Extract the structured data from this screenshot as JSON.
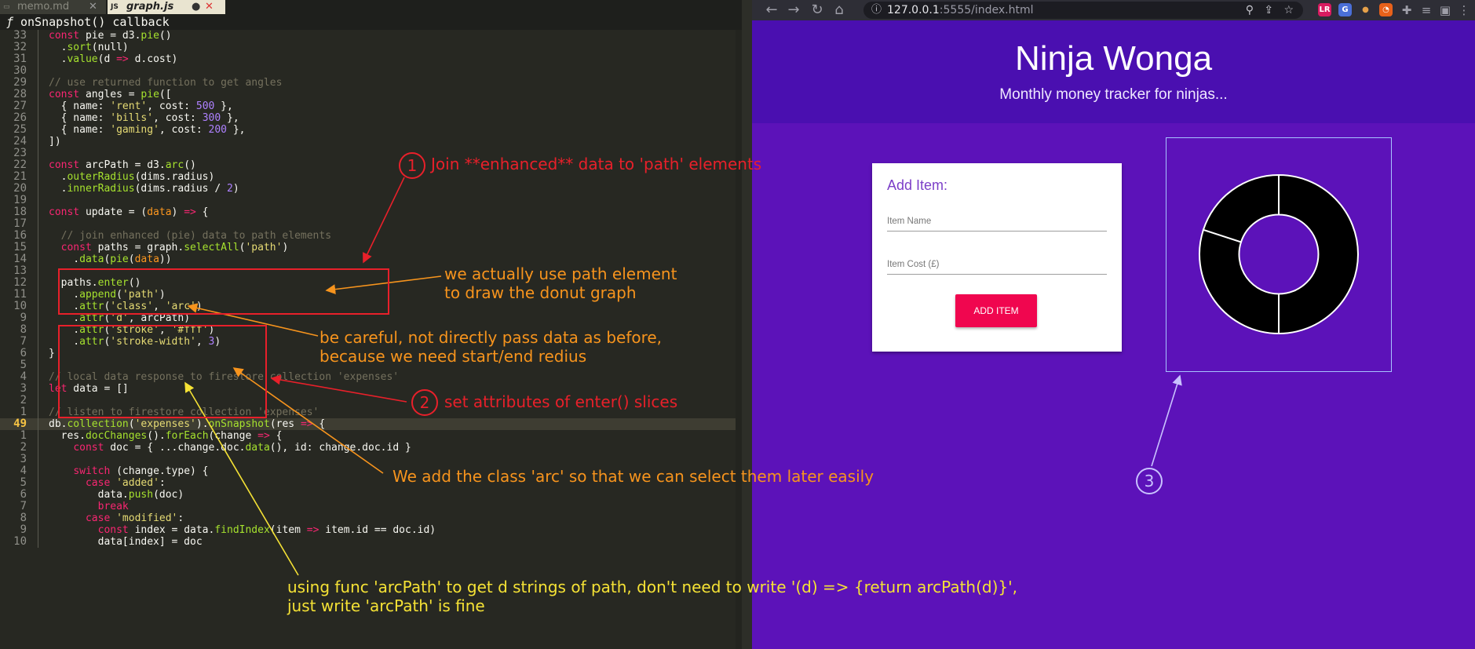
{
  "editor": {
    "tabs": [
      {
        "label": "memo.md",
        "icon": "markdown-icon",
        "active": false
      },
      {
        "label": "graph.js",
        "icon": "js-file-icon",
        "active": true,
        "modified": true
      }
    ],
    "breadcrumb": {
      "symbol": "ƒ",
      "label": "onSnapshot() callback"
    },
    "lines": [
      {
        "num": "33",
        "text": "const pie = d3.pie()"
      },
      {
        "num": "32",
        "text": "  .sort(null)"
      },
      {
        "num": "31",
        "text": "  .value(d => d.cost)"
      },
      {
        "num": "30",
        "text": ""
      },
      {
        "num": "29",
        "text": "// use returned function to get angles"
      },
      {
        "num": "28",
        "text": "const angles = pie(["
      },
      {
        "num": "27",
        "text": "  { name: 'rent', cost: 500 },"
      },
      {
        "num": "26",
        "text": "  { name: 'bills', cost: 300 },"
      },
      {
        "num": "25",
        "text": "  { name: 'gaming', cost: 200 },"
      },
      {
        "num": "24",
        "text": "])"
      },
      {
        "num": "23",
        "text": ""
      },
      {
        "num": "22",
        "text": "const arcPath = d3.arc()"
      },
      {
        "num": "21",
        "text": "  .outerRadius(dims.radius)"
      },
      {
        "num": "20",
        "text": "  .innerRadius(dims.radius / 2)"
      },
      {
        "num": "19",
        "text": ""
      },
      {
        "num": "18",
        "text": "const update = (data) => {"
      },
      {
        "num": "17",
        "text": ""
      },
      {
        "num": "16",
        "text": "  // join enhanced (pie) data to path elements"
      },
      {
        "num": "15",
        "text": "  const paths = graph.selectAll('path')"
      },
      {
        "num": "14",
        "text": "    .data(pie(data))"
      },
      {
        "num": "13",
        "text": ""
      },
      {
        "num": "12",
        "text": "  paths.enter()"
      },
      {
        "num": "11",
        "text": "    .append('path')"
      },
      {
        "num": "10",
        "text": "    .attr('class', 'arc')"
      },
      {
        "num": "9",
        "text": "    .attr('d', arcPath)"
      },
      {
        "num": "8",
        "text": "    .attr('stroke', '#fff')"
      },
      {
        "num": "7",
        "text": "    .attr('stroke-width', 3)"
      },
      {
        "num": "6",
        "text": "}"
      },
      {
        "num": "5",
        "text": ""
      },
      {
        "num": "4",
        "text": "// local data response to firestore collection 'expenses'"
      },
      {
        "num": "3",
        "text": "let data = []"
      },
      {
        "num": "2",
        "text": ""
      },
      {
        "num": "1",
        "text": "// listen to firestore collection 'expenses'"
      },
      {
        "num": "49",
        "text": "db.collection('expenses').onSnapshot(res => {",
        "current": true
      },
      {
        "num": "1",
        "text": "  res.docChanges().forEach(change => {"
      },
      {
        "num": "2",
        "text": "    const doc = { ...change.doc.data(), id: change.doc.id }"
      },
      {
        "num": "3",
        "text": ""
      },
      {
        "num": "4",
        "text": "    switch (change.type) {"
      },
      {
        "num": "5",
        "text": "      case 'added':"
      },
      {
        "num": "6",
        "text": "        data.push(doc)"
      },
      {
        "num": "7",
        "text": "        break"
      },
      {
        "num": "8",
        "text": "      case 'modified':"
      },
      {
        "num": "9",
        "text": "        const index = data.findIndex(item => item.id == doc.id)"
      },
      {
        "num": "10",
        "text": "        data[index] = doc"
      }
    ]
  },
  "annotations": {
    "step1": {
      "number": "1",
      "text": "Join **enhanced** data to 'path' elements",
      "color": "#e8202a"
    },
    "step2": {
      "number": "2",
      "text": "set attributes of enter() slices",
      "color": "#e8202a"
    },
    "step3": {
      "number": "3",
      "color": "#c9c2ff"
    },
    "path_note": "we actually use path element\nto draw the donut graph",
    "careful_note": "be careful, not directly pass data as before,\nbecause we need start/end redius",
    "class_note": "We add the class 'arc' so that we can select them later easily",
    "arcpath_note": "using func 'arcPath' to get d strings of path, don't need to write '(d) => {return arcPath(d)}',\njust write 'arcPath' is fine",
    "orange": "#f7941d",
    "yellow": "#f5e235"
  },
  "browser": {
    "url_host": "127.0.0.1",
    "url_rest": ":5555/index.html",
    "nav_icons": [
      "back-arrow-icon",
      "forward-arrow-icon",
      "reload-icon",
      "home-icon"
    ],
    "extensions": [
      {
        "name": "extension-lr-icon",
        "label": "LR",
        "color": "#d81b60"
      },
      {
        "name": "extension-translate-icon",
        "label": "G",
        "color": "#4a6fd8"
      },
      {
        "name": "extension-cookie-icon",
        "label": "🍪",
        "color": "#2e2e36"
      },
      {
        "name": "extension-speedometer-icon",
        "label": "◔",
        "color": "#e8611a"
      }
    ]
  },
  "app": {
    "title": "Ninja Wonga",
    "subtitle": "Monthly money tracker for ninjas...",
    "form": {
      "heading": "Add Item:",
      "name_placeholder": "Item Name",
      "cost_placeholder": "Item Cost (£)",
      "button_label": "ADD ITEM"
    },
    "chart_colors": {
      "fill": "#000000",
      "stroke": "#ffffff"
    }
  },
  "chart_data": {
    "type": "pie",
    "donut": true,
    "slices": [
      {
        "name": "rent",
        "value": 500
      },
      {
        "name": "bills",
        "value": 300
      },
      {
        "name": "gaming",
        "value": 200
      }
    ],
    "inner_radius_ratio": 0.5
  }
}
